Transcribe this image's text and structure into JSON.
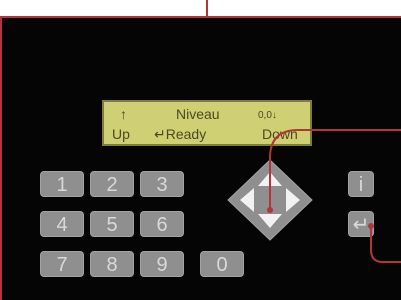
{
  "lcd": {
    "line1": {
      "left": "↑",
      "center": "Niveau",
      "right": "0,0↓"
    },
    "line2": {
      "left": "Up",
      "center": "↵Ready",
      "right": "Down"
    }
  },
  "keypad": {
    "keys": [
      "1",
      "2",
      "3",
      "4",
      "5",
      "6",
      "7",
      "8",
      "9",
      "0"
    ]
  },
  "side_keys": {
    "info": "i",
    "enter": "↵"
  },
  "colors": {
    "lcd_bg": "#cfcf74",
    "lcd_text": "#4a4a22",
    "key_bg": "#8f8f8f",
    "key_text": "#d9d9d9",
    "leader_line": "#b4343c"
  }
}
